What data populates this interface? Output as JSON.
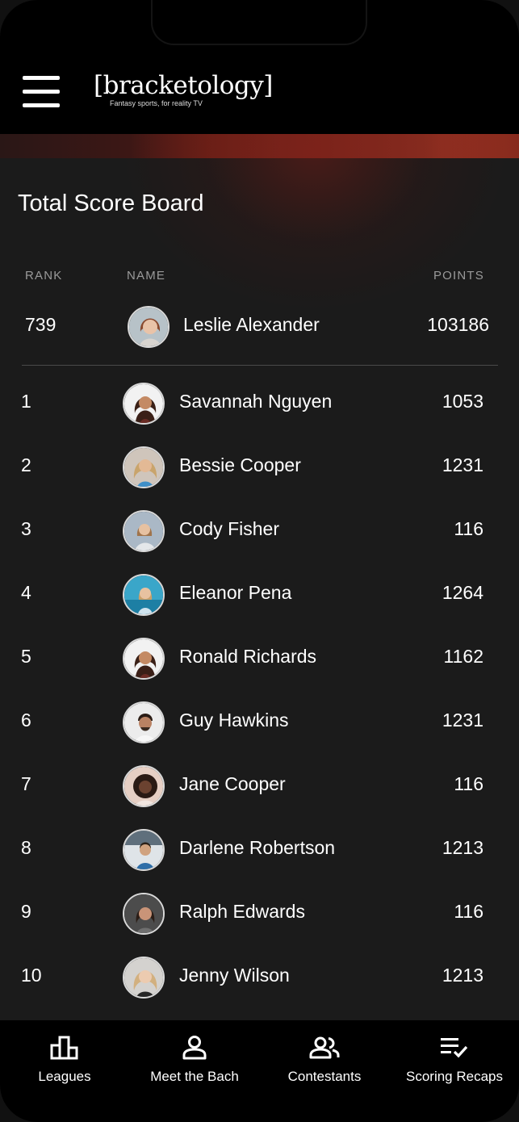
{
  "app": {
    "logo_text": "[bracketology]",
    "tagline": "Fantasy sports, for reality TV"
  },
  "icons": {
    "menu": "hamburger-menu-icon",
    "leagues": "bar-chart-icon",
    "meet_the_bach": "person-icon",
    "contestants": "people-icon",
    "scoring_recaps": "list-check-icon"
  },
  "colors": {
    "background": "#1b1b1b",
    "header": "#000000",
    "banner_accent": "#8c2a1f",
    "muted_text": "#9a9a9a"
  },
  "board": {
    "title": "Total Score Board",
    "columns": {
      "rank": "RANK",
      "name": "NAME",
      "points": "POINTS"
    },
    "current_user": {
      "rank": "739",
      "name": "Leslie Alexander",
      "points": "103186"
    },
    "rows": [
      {
        "rank": "1",
        "name": "Savannah Nguyen",
        "points": "1053"
      },
      {
        "rank": "2",
        "name": "Bessie Cooper",
        "points": "1231"
      },
      {
        "rank": "3",
        "name": "Cody Fisher",
        "points": "116"
      },
      {
        "rank": "4",
        "name": "Eleanor Pena",
        "points": "1264"
      },
      {
        "rank": "5",
        "name": "Ronald Richards",
        "points": "1162"
      },
      {
        "rank": "6",
        "name": "Guy Hawkins",
        "points": "1231"
      },
      {
        "rank": "7",
        "name": "Jane Cooper",
        "points": "116"
      },
      {
        "rank": "8",
        "name": "Darlene Robertson",
        "points": "1213"
      },
      {
        "rank": "9",
        "name": "Ralph Edwards",
        "points": "116"
      },
      {
        "rank": "10",
        "name": "Jenny Wilson",
        "points": "1213"
      }
    ]
  },
  "tabs": [
    {
      "label": "Leagues"
    },
    {
      "label": "Meet the Bach"
    },
    {
      "label": "Contestants"
    },
    {
      "label": "Scoring Recaps"
    }
  ]
}
